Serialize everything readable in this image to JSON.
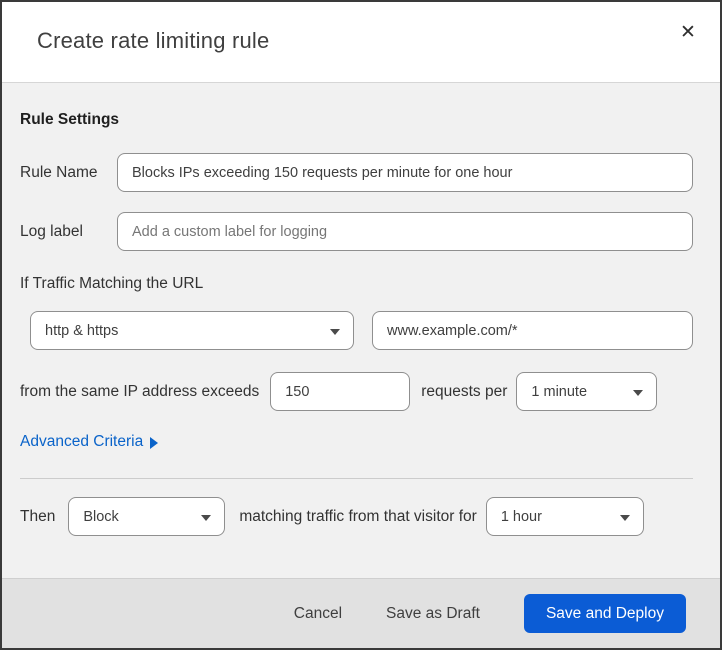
{
  "dialog": {
    "title": "Create rate limiting rule"
  },
  "icons": {
    "close": "✕"
  },
  "colors": {
    "accent_blue": "#0b5cd5",
    "link_blue": "#0a63c9",
    "body_bg": "#f1f1f1",
    "footer_bg": "#e1e1e1",
    "top_strip_navy": "#06202f"
  },
  "rule_settings": {
    "heading": "Rule Settings",
    "rule_name": {
      "label": "Rule Name",
      "value": "Blocks IPs exceeding 150 requests per minute for one hour"
    },
    "log_label": {
      "label": "Log label",
      "placeholder": "Add a custom label for logging"
    }
  },
  "traffic_match": {
    "heading": "If Traffic Matching the URL",
    "scheme_select": {
      "value": "http & https"
    },
    "url_input": {
      "value": "www.example.com/*"
    },
    "threshold": {
      "prefix": "from the same IP address exceeds",
      "requests_value": "150",
      "middle": "requests per",
      "period_select": {
        "value": "1 minute"
      }
    },
    "advanced_link": "Advanced Criteria"
  },
  "action": {
    "then_label": "Then",
    "action_select": {
      "value": "Block"
    },
    "middle": "matching traffic from that visitor for",
    "duration_select": {
      "value": "1 hour"
    }
  },
  "footer": {
    "cancel": "Cancel",
    "save_draft": "Save as Draft",
    "save_deploy": "Save and Deploy"
  }
}
